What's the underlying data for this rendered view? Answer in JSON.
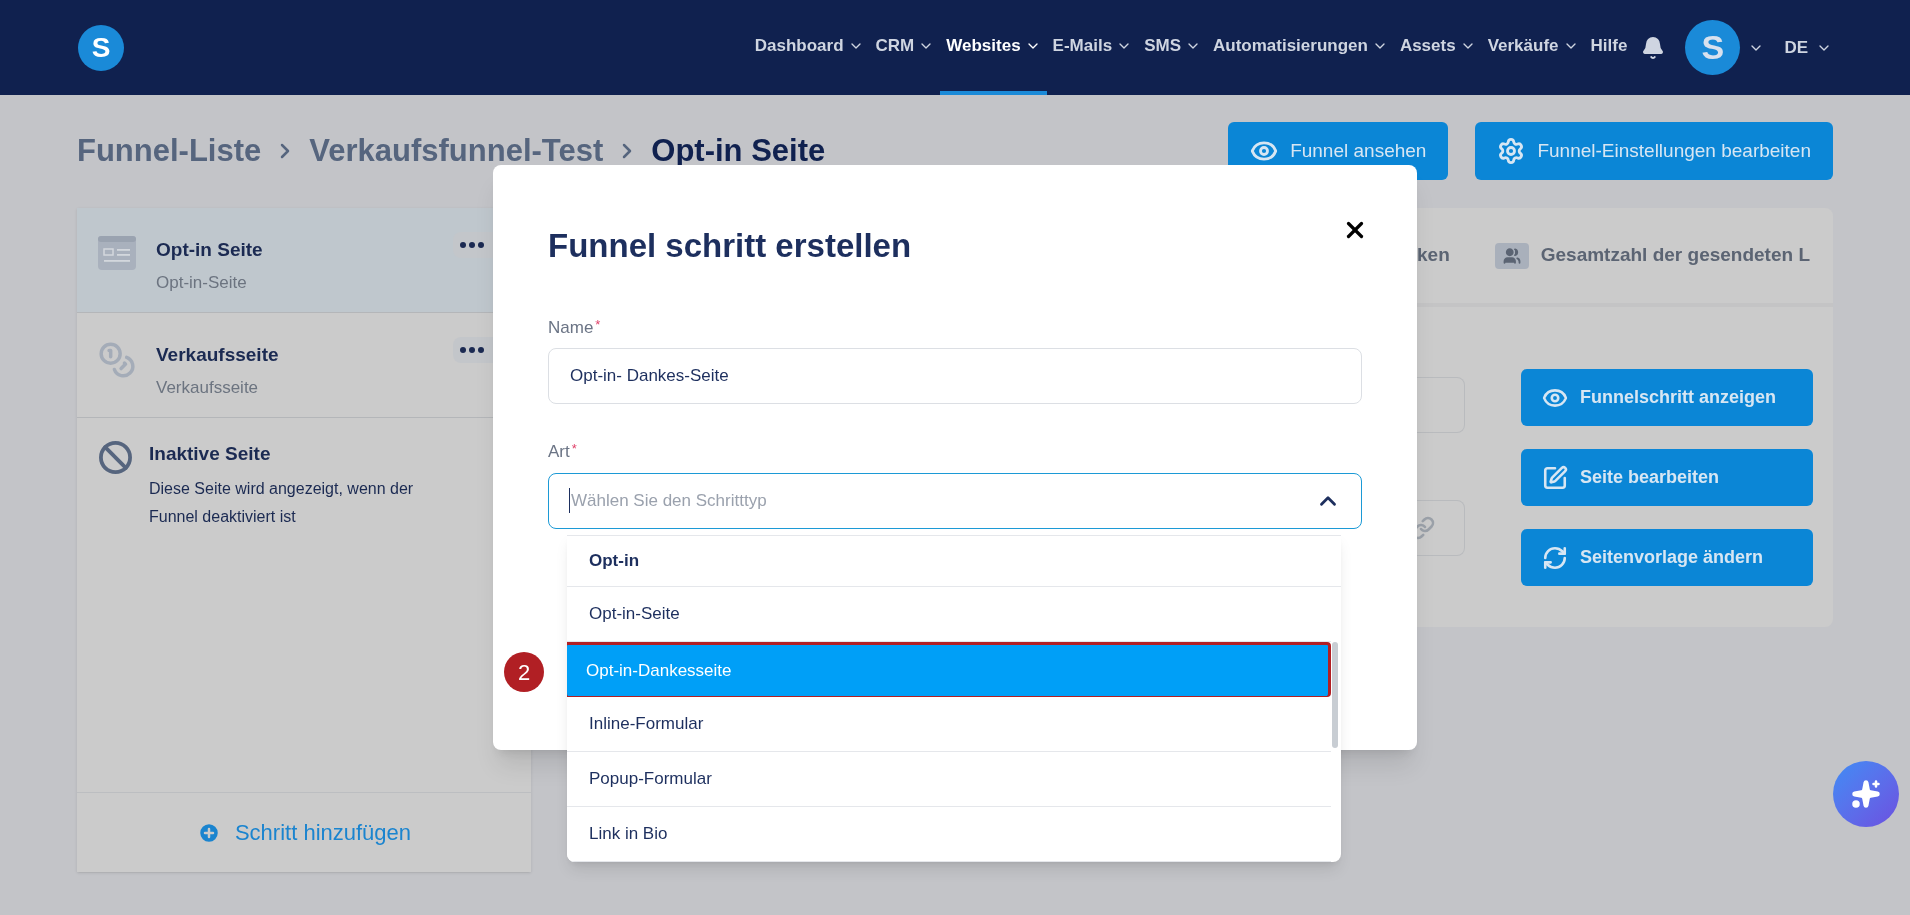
{
  "nav": {
    "logo": "S",
    "items": [
      {
        "label": "Dashboard",
        "selected": false,
        "has_menu": true
      },
      {
        "label": "CRM",
        "selected": false,
        "has_menu": true
      },
      {
        "label": "Websites",
        "selected": true,
        "has_menu": true
      },
      {
        "label": "E-Mails",
        "selected": false,
        "has_menu": true
      },
      {
        "label": "SMS",
        "selected": false,
        "has_menu": true
      },
      {
        "label": "Automatisierungen",
        "selected": false,
        "has_menu": true
      },
      {
        "label": "Assets",
        "selected": false,
        "has_menu": true
      },
      {
        "label": "Verkäufe",
        "selected": false,
        "has_menu": true
      },
      {
        "label": "Hilfe",
        "selected": false,
        "has_menu": false
      }
    ],
    "avatar": "S",
    "language": "DE"
  },
  "breadcrumb": [
    "Funnel-Liste",
    "Verkaufsfunnel-Test",
    "Opt-in Seite"
  ],
  "header_buttons": [
    {
      "label": "Funnel ansehen"
    },
    {
      "label": "Funnel-Einstellungen bearbeiten"
    }
  ],
  "steps": [
    {
      "title": "Opt-in Seite",
      "subtitle": "Opt-in-Seite",
      "kind": "optin",
      "selected": true
    },
    {
      "title": "Verkaufsseite",
      "subtitle": "Verkaufsseite",
      "kind": "sales",
      "selected": false
    }
  ],
  "inactive_page": {
    "title": "Inaktive Seite",
    "description": "Diese Seite wird angezeigt, wenn der Funnel deaktiviert ist"
  },
  "add_step": "Schritt hinzufügen",
  "stats_tabs": [
    {
      "label": "ken"
    },
    {
      "label": "Gesamtzahl der gesendeten L"
    }
  ],
  "step_actions": [
    {
      "label": "Funnelschritt anzeigen"
    },
    {
      "label": "Seite bearbeiten"
    },
    {
      "label": "Seitenvorlage ändern"
    }
  ],
  "dialog": {
    "title": "Funnel schritt erstellen",
    "fields": [
      {
        "kind": "text",
        "label": "Name",
        "required_mark": "*",
        "value": "Opt-in- Dankes-Seite"
      },
      {
        "kind": "select",
        "label": "Art",
        "required_mark": "*",
        "placeholder": "Wählen Sie den Schritttyp",
        "expanded": true
      }
    ]
  },
  "dropdown": [
    {
      "kind": "group",
      "label": "Opt-in"
    },
    {
      "kind": "option",
      "label": "Opt-in-Seite",
      "selected": false,
      "highlighted": false
    },
    {
      "kind": "option",
      "label": "Opt-in-Dankesseite",
      "selected": true,
      "highlighted": true
    },
    {
      "kind": "option",
      "label": "Inline-Formular",
      "selected": false,
      "highlighted": false
    },
    {
      "kind": "option",
      "label": "Popup-Formular",
      "selected": false,
      "highlighted": false
    },
    {
      "kind": "option",
      "label": "Link in Bio",
      "selected": false,
      "highlighted": false
    }
  ],
  "callout": {
    "label": "2"
  }
}
